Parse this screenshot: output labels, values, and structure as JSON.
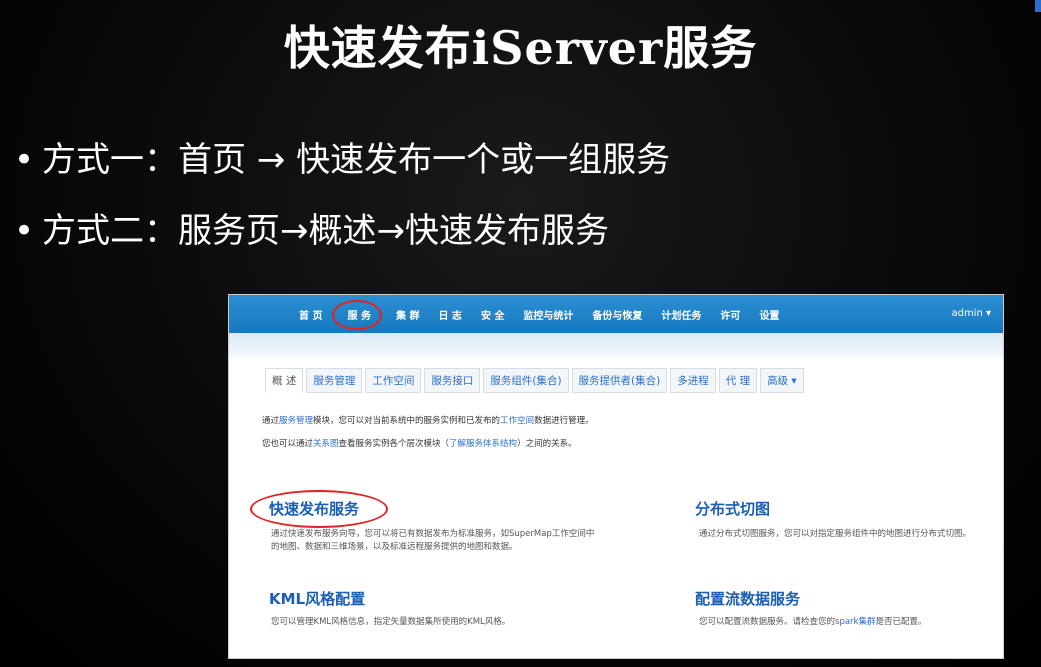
{
  "slide": {
    "title_cn_1": "快速发布",
    "title_en": "iServer",
    "title_cn_2": "服务",
    "bullets": [
      "方式一：首页 → 快速发布一个或一组服务",
      "方式二：服务页→概述→快速发布服务"
    ]
  },
  "screenshot": {
    "nav": {
      "items": [
        "首 页",
        "服 务",
        "集 群",
        "日 志",
        "安 全",
        "监控与统计",
        "备份与恢复",
        "计划任务",
        "许可",
        "设置"
      ],
      "user": "admin ▾"
    },
    "tabs": [
      "概 述",
      "服务管理",
      "工作空间",
      "服务接口",
      "服务组件(集合)",
      "服务提供者(集合)",
      "多进程",
      "代 理",
      "高级 ▾"
    ],
    "desc1": {
      "pre": "通过",
      "link1": "服务管理",
      "mid": "模块，您可以对当前系统中的服务实例和已发布的",
      "link2": "工作空间",
      "post": "数据进行管理。"
    },
    "desc2": {
      "pre": "您也可以通过",
      "link1": "关系图",
      "mid": "查看服务实例各个层次模块（",
      "link2": "了解服务体系结构",
      "post": "）之间的关系。"
    },
    "cards": [
      {
        "title": "快速发布服务",
        "text": "通过快速发布服务向导，您可以将已有数据发布为标准服务，如SuperMap工作空间中的地图、数据和三维场景，以及标准远程服务提供的地图和数据。"
      },
      {
        "title": "分布式切图",
        "text": "通过分布式切图服务，您可以对指定服务组件中的地图进行分布式切图。"
      },
      {
        "title": "KML风格配置",
        "text": "您可以管理KML风格信息，指定矢量数据集所使用的KML风格。"
      },
      {
        "title": "配置流数据服务",
        "text_pre": "您可以配置流数据服务。请检查您的",
        "text_link": "spark集群",
        "text_post": "是否已配置。"
      }
    ]
  }
}
